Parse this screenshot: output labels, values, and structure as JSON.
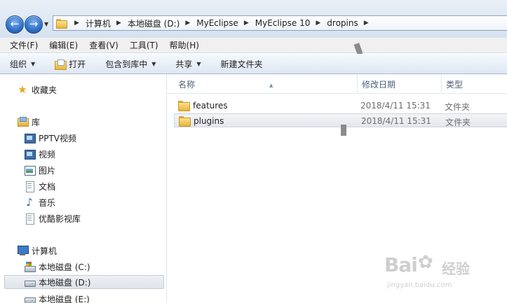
{
  "address": {
    "crumbs": [
      "计算机",
      "本地磁盘 (D:)",
      "MyEclipse",
      "MyEclipse 10",
      "dropins"
    ]
  },
  "menu": {
    "items": [
      "文件(F)",
      "编辑(E)",
      "查看(V)",
      "工具(T)",
      "帮助(H)"
    ]
  },
  "toolbar": {
    "organize": "组织",
    "open": "打开",
    "include_library": "包含到库中",
    "share": "共享",
    "new_folder": "新建文件夹"
  },
  "nav": {
    "favorites": "收藏夹",
    "libraries": "库",
    "library_items": [
      "PPTV视频",
      "视频",
      "图片",
      "文档",
      "音乐",
      "优酷影视库"
    ],
    "computer": "计算机",
    "drives": [
      "本地磁盘 (C:)",
      "本地磁盘 (D:)",
      "本地磁盘 (E:)"
    ],
    "selected_drive": "本地磁盘 (D:)"
  },
  "list": {
    "columns": {
      "name": "名称",
      "date": "修改日期",
      "type": "类型"
    },
    "rows": [
      {
        "name": "features",
        "date": "2018/4/11 15:31",
        "type": "文件夹",
        "selected": false
      },
      {
        "name": "plugins",
        "date": "2018/4/11 15:31",
        "type": "文件夹",
        "selected": true
      }
    ]
  },
  "watermark": {
    "logo": "Bai",
    "logo_cn": "经验",
    "url": "jingyan.baidu.com"
  },
  "icons": {
    "back": "back-arrow-icon",
    "forward": "forward-arrow-icon",
    "folder": "folder-icon",
    "favorites": "star-icon",
    "computer": "computer-icon",
    "drive": "drive-icon"
  },
  "colors": {
    "accent": "#2f6fc6",
    "folder": "#e9b53e",
    "header_text": "#4c607a"
  }
}
